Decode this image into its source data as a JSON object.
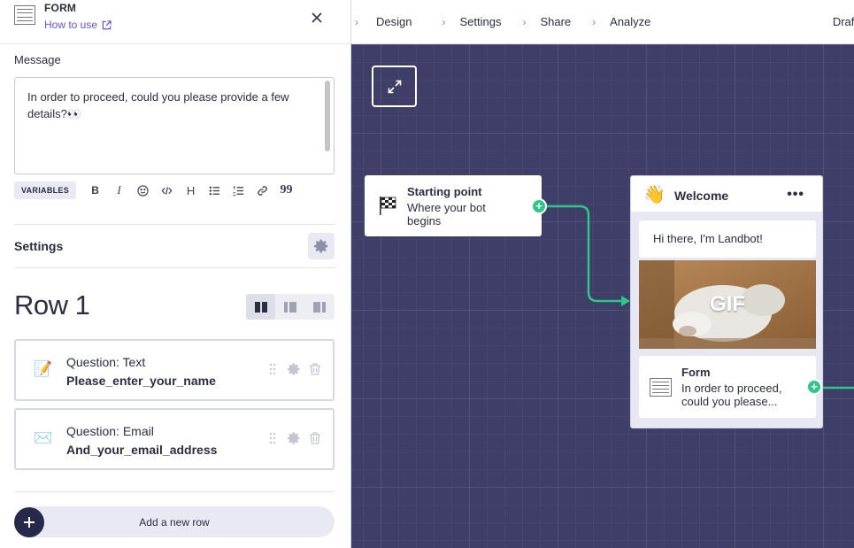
{
  "nav": {
    "items": [
      "Design",
      "Settings",
      "Share",
      "Analyze"
    ],
    "status": "Draft"
  },
  "panel": {
    "title": "FORM",
    "how_to_use": "How to use",
    "message_label": "Message",
    "message_text": "In order to proceed, could you please provide a few details?👀",
    "variables_label": "VARIABLES",
    "toolbar_bold": "B",
    "toolbar_italic": "I",
    "toolbar_heading": "H",
    "toolbar_quote": "99",
    "settings_label": "Settings",
    "row_title": "Row 1",
    "questions": [
      {
        "icon": "📝",
        "type": "Question: Text",
        "variable": "Please_enter_your_name"
      },
      {
        "icon": "✉️",
        "type": "Question: Email",
        "variable": "And_your_email_address"
      }
    ],
    "add_row_label": "Add a new row"
  },
  "canvas": {
    "start_node": {
      "title": "Starting point",
      "subtitle": "Where your bot begins"
    },
    "welcome_node": {
      "emoji": "👋",
      "title": "Welcome",
      "more": "•••",
      "message": "Hi there, I'm Landbot!",
      "gif_label": "GIF",
      "form_title": "Form",
      "form_sub": "In order to proceed, could you please..."
    }
  },
  "colors": {
    "canvas_bg": "#3e3e68",
    "accent_link": "#6a4cf1",
    "port_green": "#2ec78a",
    "dark_navy": "#27294a"
  }
}
